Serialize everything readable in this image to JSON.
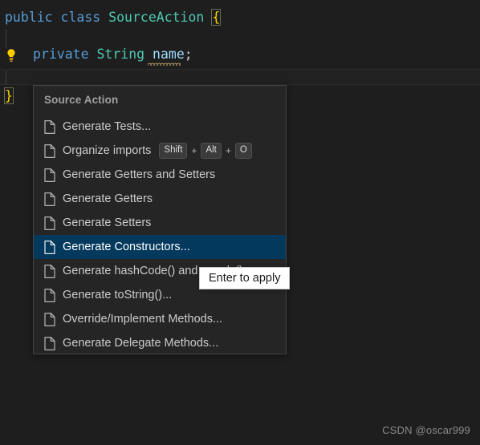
{
  "editor": {
    "background_color": "#1e1e1e",
    "lines": [
      {
        "id": "line1",
        "tokens": [
          {
            "text": "public",
            "kind": "keyword"
          },
          {
            "text": " ",
            "kind": "plain"
          },
          {
            "text": "class",
            "kind": "keyword"
          },
          {
            "text": " ",
            "kind": "plain"
          },
          {
            "text": "SourceAction",
            "kind": "class"
          },
          {
            "text": " ",
            "kind": "plain"
          },
          {
            "text": "{",
            "kind": "brace-match"
          }
        ]
      },
      {
        "id": "line2",
        "tokens": [
          {
            "text": "private",
            "kind": "keyword"
          },
          {
            "text": " ",
            "kind": "plain"
          },
          {
            "text": "String",
            "kind": "type"
          },
          {
            "text": " ",
            "kind": "plain"
          },
          {
            "text": "name",
            "kind": "identifier"
          },
          {
            "text": ";",
            "kind": "plain"
          }
        ]
      },
      {
        "id": "line3",
        "tokens": [
          {
            "text": "}",
            "kind": "brace-match"
          }
        ]
      }
    ],
    "code_text_line1": "public class SourceAction {",
    "code_text_line2": "private String name;",
    "code_text_line3": "}",
    "lightbulb_tooltip": "Show Code Actions"
  },
  "source_action_menu": {
    "title": "Source Action",
    "items": [
      {
        "label": "Generate Tests...",
        "keys": [],
        "selected": false
      },
      {
        "label": "Organize imports",
        "keys": [
          "Shift",
          "Alt",
          "O"
        ],
        "selected": false
      },
      {
        "label": "Generate Getters and Setters",
        "keys": [],
        "selected": false
      },
      {
        "label": "Generate Getters",
        "keys": [],
        "selected": false
      },
      {
        "label": "Generate Setters",
        "keys": [],
        "selected": false
      },
      {
        "label": "Generate Constructors...",
        "keys": [],
        "selected": true
      },
      {
        "label": "Generate hashCode() and equals()...",
        "keys": [],
        "selected": false
      },
      {
        "label": "Generate toString()...",
        "keys": [],
        "selected": false
      },
      {
        "label": "Override/Implement Methods...",
        "keys": [],
        "selected": false
      },
      {
        "label": "Generate Delegate Methods...",
        "keys": [],
        "selected": false
      }
    ],
    "selected_index": 5,
    "key_separator": "+",
    "selection_color": "#04395e",
    "panel_background": "#252526",
    "panel_border": "#454545"
  },
  "tooltip": {
    "text": "Enter to apply",
    "background": "#ffffff",
    "text_color": "#1a1a1a"
  },
  "watermark": {
    "text": "CSDN @oscar999"
  },
  "colors": {
    "keyword": "#569cd6",
    "type": "#4ec9b0",
    "identifier": "#9cdcfe",
    "brace_match": "#ffd700",
    "squiggle": "#e5c07b",
    "lightbulb": "#ffcc00"
  }
}
